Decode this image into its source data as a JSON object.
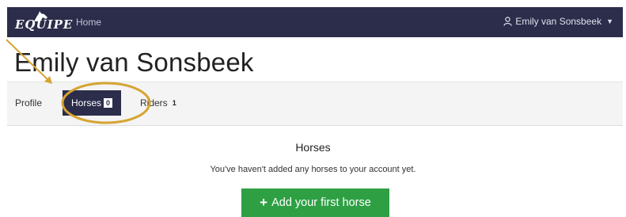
{
  "navbar": {
    "logo_text": "EQUIPE",
    "home_label": "Home",
    "user_name": "Emily van Sonsbeek",
    "user_icon": "user-icon",
    "caret_icon": "caret-down-icon"
  },
  "profile": {
    "title": "Emily van Sonsbeek"
  },
  "tabs": [
    {
      "label": "Profile"
    },
    {
      "label": "Horses",
      "count": "0",
      "active": true
    },
    {
      "label": "Riders",
      "count": "1"
    }
  ],
  "horses": {
    "section_title": "Horses",
    "empty_message": "You've haven't added any horses to your account yet.",
    "add_button_label": "Add your first horse",
    "add_icon": "plus-icon"
  },
  "colors": {
    "navbar_bg": "#2b2d4a",
    "active_tab_bg": "#2b2d4a",
    "add_button_bg": "#2ea043",
    "annotation": "#d6a431"
  }
}
